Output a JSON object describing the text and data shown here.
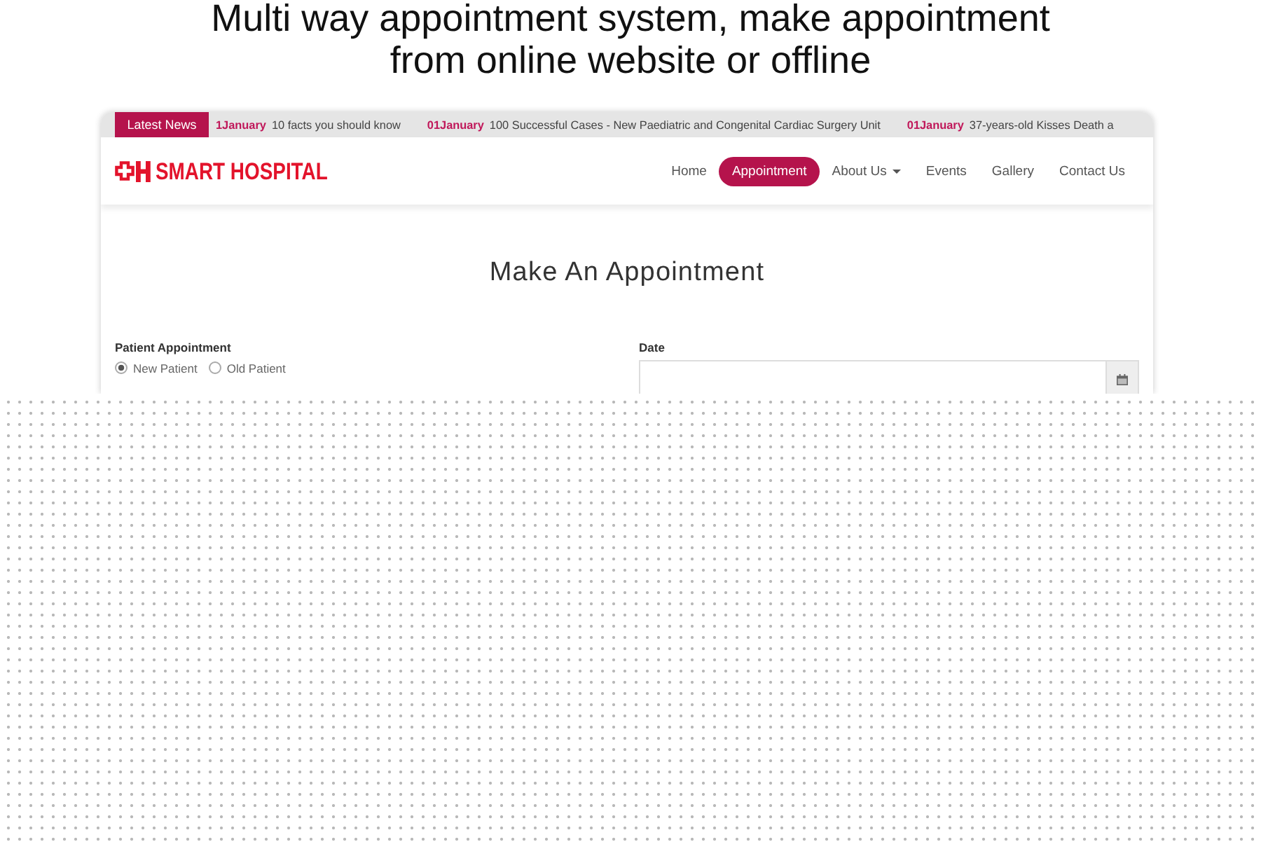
{
  "heading": "Multi way appointment system, make appointment from online website or offline",
  "news_bar": {
    "label": "Latest News",
    "items": [
      {
        "date": "1January",
        "text": "10 facts you should know"
      },
      {
        "date": "01January",
        "text": "100 Successful Cases - New Paediatric and Congenital Cardiac Surgery Unit"
      },
      {
        "date": "01January",
        "text": "37-years-old Kisses Death a"
      }
    ]
  },
  "header": {
    "logo": "SMART HOSPITAL",
    "nav": [
      {
        "label": "Home",
        "selected": false,
        "dropdown": false
      },
      {
        "label": "Appointment",
        "selected": true,
        "dropdown": false
      },
      {
        "label": "About Us",
        "selected": false,
        "dropdown": true
      },
      {
        "label": "Events",
        "selected": false,
        "dropdown": false
      },
      {
        "label": "Gallery",
        "selected": false,
        "dropdown": false
      },
      {
        "label": "Contact Us",
        "selected": false,
        "dropdown": false
      }
    ]
  },
  "page_title": "Make An Appointment",
  "form": {
    "patient_type": {
      "label": "Patient Appointment",
      "options": [
        {
          "label": "New Patient",
          "selected": true
        },
        {
          "label": "Old Patient",
          "selected": false
        }
      ]
    },
    "date": {
      "label": "Date"
    }
  }
}
